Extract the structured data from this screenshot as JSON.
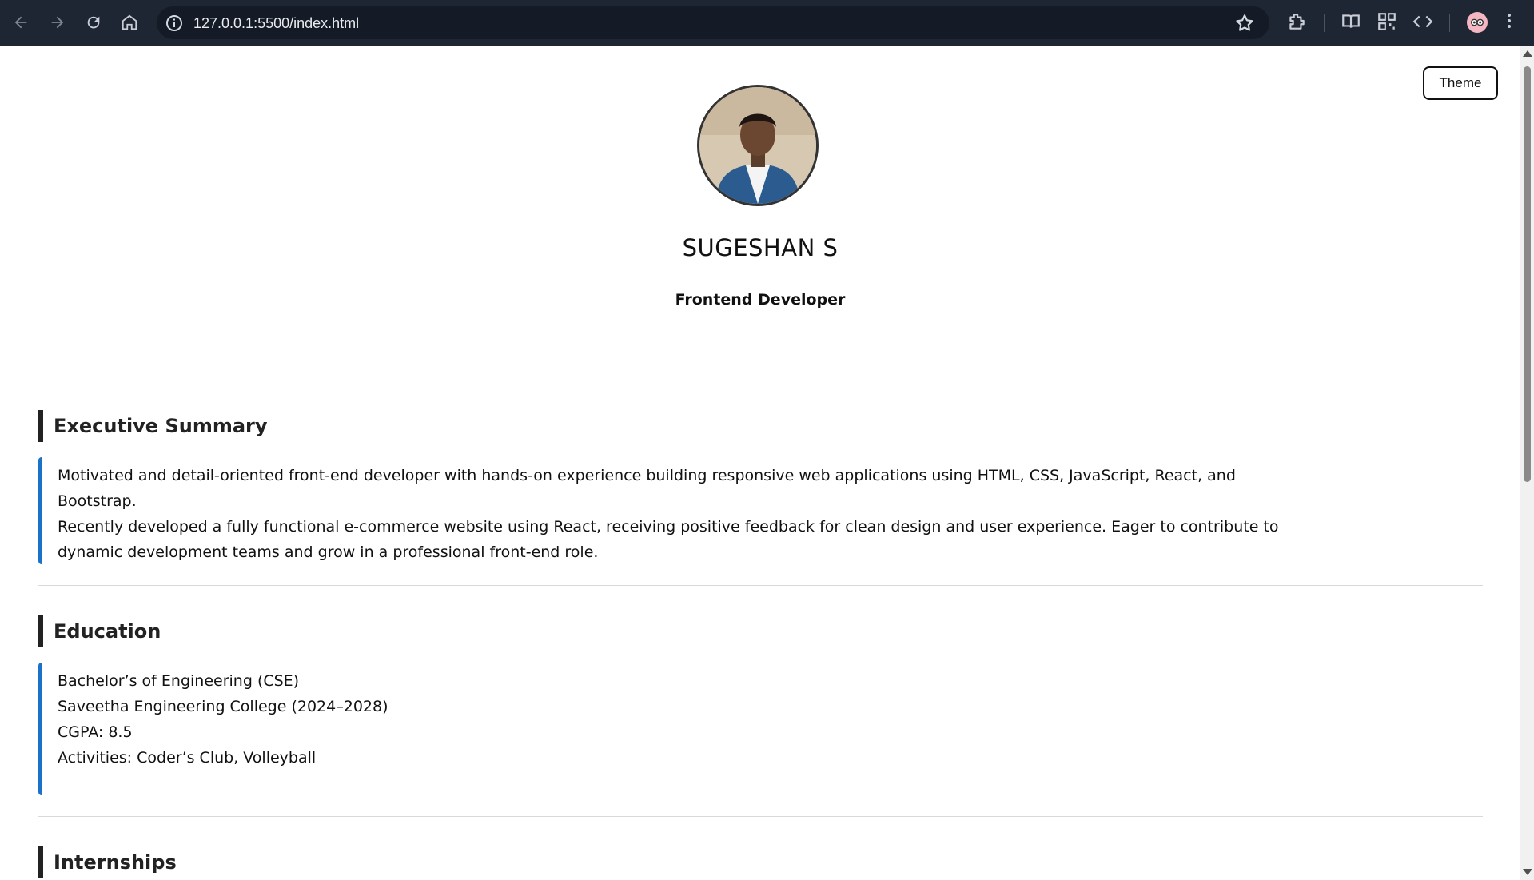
{
  "browser": {
    "url": "127.0.0.1:5500/index.html"
  },
  "page": {
    "theme_button": "Theme",
    "name": "SUGESHAN S",
    "role": "Frontend Developer",
    "sections": {
      "summary": {
        "title": "Executive Summary",
        "lines": [
          "Motivated and detail-oriented front-end developer with hands-on experience building responsive web applications using HTML, CSS, JavaScript, React, and Bootstrap.",
          "Recently developed a fully functional e-commerce website using React, receiving positive feedback for clean design and user experience. Eager to contribute to",
          "dynamic development teams and grow in a professional front-end role."
        ]
      },
      "education": {
        "title": "Education",
        "lines": [
          "Bachelor’s of Engineering (CSE)",
          "Saveetha Engineering College (2024–2028)",
          "CGPA: 8.5",
          "Activities: Coder’s Club, Volleyball"
        ]
      },
      "internships": {
        "title": "Internships"
      }
    }
  },
  "colors": {
    "chrome_bg": "#1f2633",
    "accent_border": "#1a73c9",
    "heading_border": "#222222"
  }
}
